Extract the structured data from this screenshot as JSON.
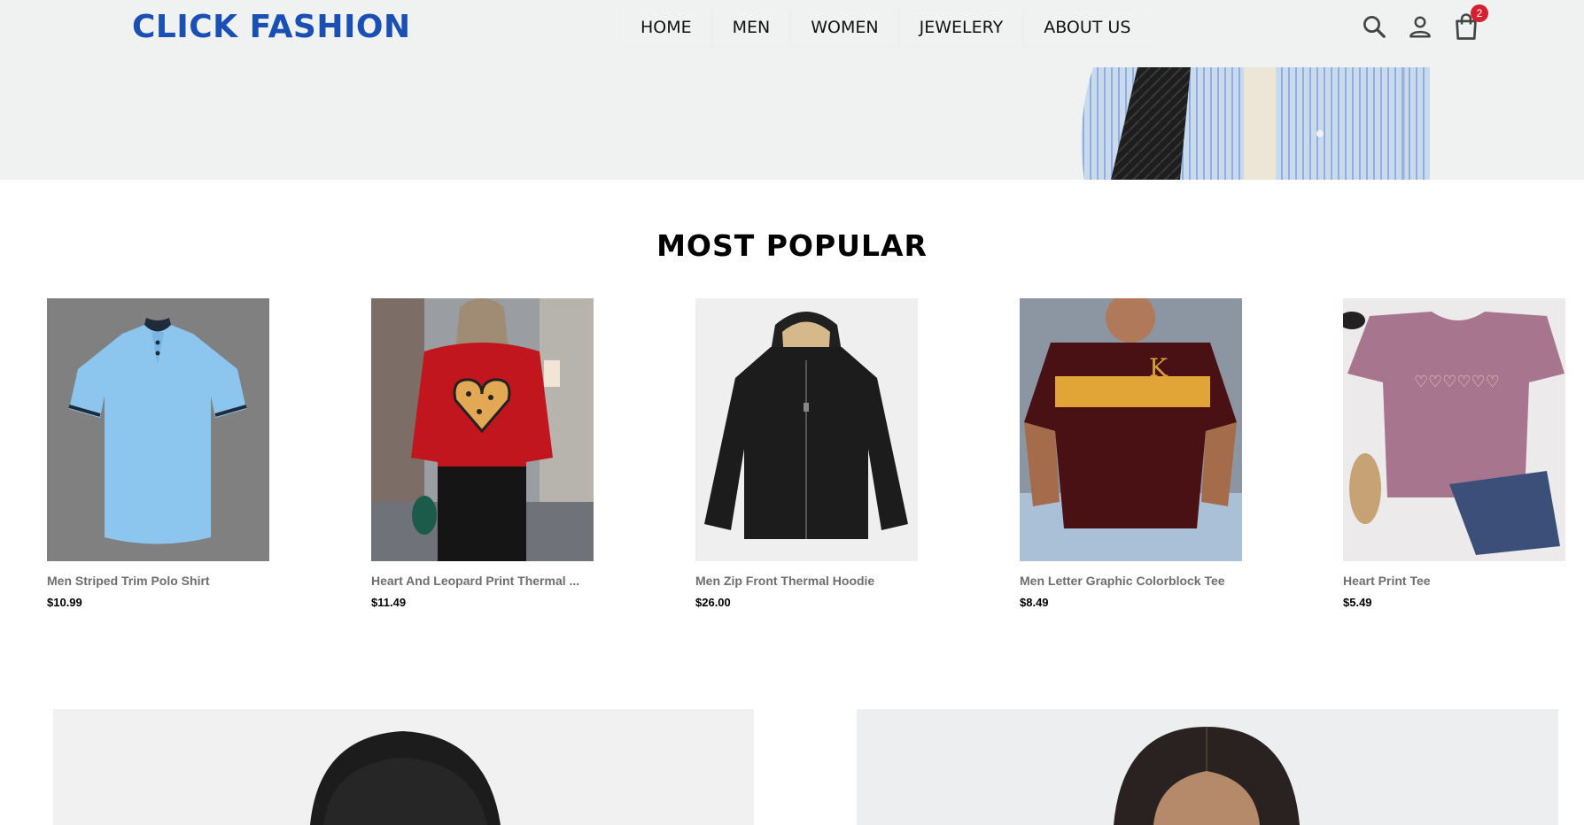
{
  "brand": {
    "logo_text": "CLICK FASHION",
    "color": "#1a4fb4"
  },
  "nav": {
    "items": [
      {
        "label": "HOME"
      },
      {
        "label": "MEN"
      },
      {
        "label": "WOMEN"
      },
      {
        "label": "JEWELERY"
      },
      {
        "label": "ABOUT US"
      }
    ]
  },
  "actions": {
    "icons": [
      "search-icon",
      "user-icon",
      "shopping-bag-icon"
    ],
    "cart_count": "2",
    "badge_color": "#d4202f"
  },
  "section": {
    "title": "MOST POPULAR"
  },
  "products": [
    {
      "name": "Men Striped Trim Polo Shirt",
      "price": "$10.99"
    },
    {
      "name": "Heart And Leopard Print Thermal ...",
      "price": "$11.49"
    },
    {
      "name": "Men Zip Front Thermal Hoodie",
      "price": "$26.00"
    },
    {
      "name": "Men Letter Graphic Colorblock Tee",
      "price": "$8.49"
    },
    {
      "name": "Heart Print Tee",
      "price": "$5.49"
    }
  ]
}
